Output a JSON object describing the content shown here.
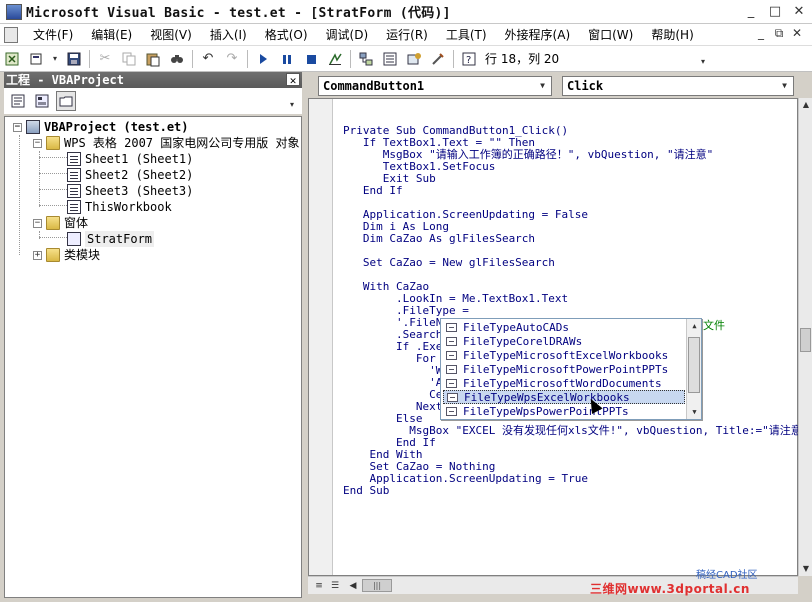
{
  "window": {
    "title": "Microsoft Visual Basic - test.et - [StratForm (代码)]",
    "min": "_",
    "max": "□",
    "close": "✕"
  },
  "menu": {
    "items": [
      "文件(F)",
      "编辑(E)",
      "视图(V)",
      "插入(I)",
      "格式(O)",
      "调试(D)",
      "运行(R)",
      "工具(T)",
      "外接程序(A)",
      "窗口(W)",
      "帮助(H)"
    ],
    "mdi_min": "_",
    "mdi_restore": "⧉",
    "mdi_close": "✕"
  },
  "toolbar": {
    "position_text": "行 18，列 20"
  },
  "project": {
    "title": "工程 - VBAProject",
    "close": "✕",
    "tree": {
      "root": "VBAProject (test.et)",
      "wps_folder": "WPS 表格 2007 国家电网公司专用版 对象",
      "sheets": [
        "Sheet1 (Sheet1)",
        "Sheet2 (Sheet2)",
        "Sheet3 (Sheet3)",
        "ThisWorkbook"
      ],
      "forms_folder": "窗体",
      "form": "StratForm",
      "class_folder": "类模块"
    }
  },
  "editor": {
    "object_combo": "CommandButton1",
    "proc_combo": "Click",
    "lines": [
      "Private Sub CommandButton1_Click()",
      "   If TextBox1.Text = \"\" Then",
      "      MsgBox \"请输入工作簿的正确路径！\", vbQuestion, \"请注意\"",
      "      TextBox1.SetFocus",
      "      Exit Sub",
      "   End If",
      "",
      "   Application.ScreenUpdating = False",
      "   Dim i As Long",
      "   Dim CaZao As glFilesSearch",
      "",
      "   Set CaZao = New glFilesSearch",
      "",
      "   With CaZao",
      "        .LookIn = Me.TextBox1.Text",
      "        .FileType =",
      "        '.FileN",
      "        .Search",
      "        If .Exec",
      "           For i",
      "             'Wo",
      "             'Ac",
      "             Cel",
      "           Next",
      "        Else",
      "          MsgBox \"EXCEL 没有发现任何xls文件!\", vbQuestion, Title:=\"请注意\"",
      "        End If",
      "    End With",
      "    Set CaZao = Nothing",
      "    Application.ScreenUpdating = True",
      "End Sub"
    ],
    "line16_tail": "文件"
  },
  "intellisense": {
    "items": [
      "FileTypeAutoCADs",
      "FileTypeCorelDRAWs",
      "FileTypeMicrosoftExcelWorkbooks",
      "FileTypeMicrosoftPowerPointPPTs",
      "FileTypeMicrosoftWordDocuments",
      "FileTypeWpsExcelWorkbooks",
      "FileTypeWpsPowerPointPPTs"
    ],
    "selected_index": 5
  },
  "watermark": {
    "text": "三维网www.3dportal.cn",
    "logo_text": "稿经CAD社区"
  }
}
